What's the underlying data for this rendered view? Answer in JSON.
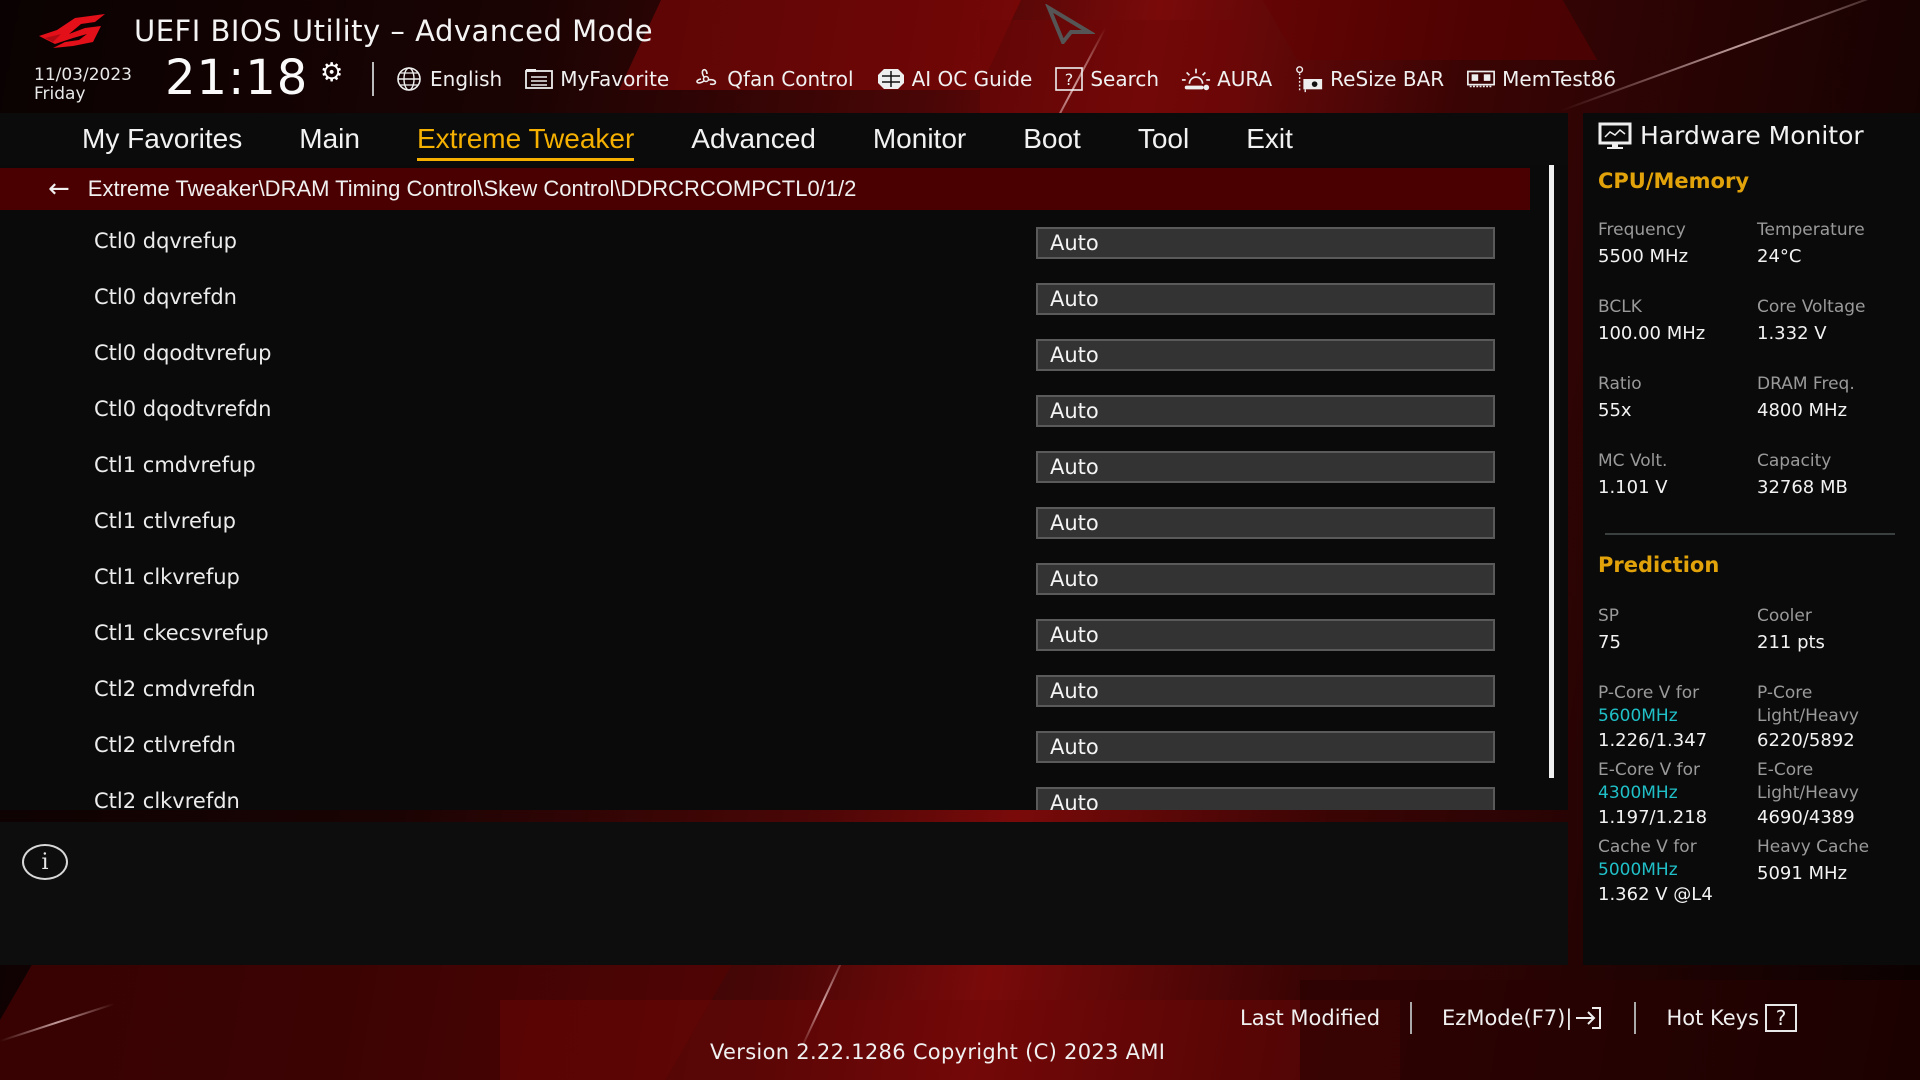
{
  "header": {
    "title": "UEFI BIOS Utility – Advanced Mode",
    "date": "11/03/2023",
    "weekday": "Friday",
    "time": "21:18"
  },
  "toolbar": [
    {
      "label": "English",
      "icon": "globe-icon"
    },
    {
      "label": "MyFavorite",
      "icon": "favorite-list-icon"
    },
    {
      "label": "Qfan Control",
      "icon": "fan-icon"
    },
    {
      "label": "AI OC Guide",
      "icon": "ai-chip-icon"
    },
    {
      "label": "Search",
      "icon": "search-help-icon"
    },
    {
      "label": "AURA",
      "icon": "aura-light-icon"
    },
    {
      "label": "ReSize BAR",
      "icon": "resize-bar-icon"
    },
    {
      "label": "MemTest86",
      "icon": "memory-module-icon"
    }
  ],
  "nav": {
    "tabs": [
      {
        "label": "My Favorites",
        "active": false
      },
      {
        "label": "Main",
        "active": false
      },
      {
        "label": "Extreme Tweaker",
        "active": true
      },
      {
        "label": "Advanced",
        "active": false
      },
      {
        "label": "Monitor",
        "active": false
      },
      {
        "label": "Boot",
        "active": false
      },
      {
        "label": "Tool",
        "active": false
      },
      {
        "label": "Exit",
        "active": false
      }
    ]
  },
  "breadcrumb": {
    "path": "Extreme Tweaker\\DRAM Timing Control\\Skew Control\\DDRCRCOMPCTL0/1/2"
  },
  "settings": [
    {
      "label": "Ctl0 dqvrefup",
      "value": "Auto"
    },
    {
      "label": "Ctl0 dqvrefdn",
      "value": "Auto"
    },
    {
      "label": "Ctl0 dqodtvrefup",
      "value": "Auto"
    },
    {
      "label": "Ctl0 dqodtvrefdn",
      "value": "Auto"
    },
    {
      "label": "Ctl1 cmdvrefup",
      "value": "Auto"
    },
    {
      "label": "Ctl1 ctlvrefup",
      "value": "Auto"
    },
    {
      "label": "Ctl1 clkvrefup",
      "value": "Auto"
    },
    {
      "label": "Ctl1 ckecsvrefup",
      "value": "Auto"
    },
    {
      "label": "Ctl2 cmdvrefdn",
      "value": "Auto"
    },
    {
      "label": "Ctl2 ctlvrefdn",
      "value": "Auto"
    },
    {
      "label": "Ctl2 clkvrefdn",
      "value": "Auto"
    }
  ],
  "hardware_monitor": {
    "title": "Hardware Monitor",
    "cpu_memory": {
      "heading": "CPU/Memory",
      "items": [
        {
          "label": "Frequency",
          "value": "5500 MHz"
        },
        {
          "label": "Temperature",
          "value": "24°C"
        },
        {
          "label": "BCLK",
          "value": "100.00 MHz"
        },
        {
          "label": "Core Voltage",
          "value": "1.332 V"
        },
        {
          "label": "Ratio",
          "value": "55x"
        },
        {
          "label": "DRAM Freq.",
          "value": "4800 MHz"
        },
        {
          "label": "MC Volt.",
          "value": "1.101 V"
        },
        {
          "label": "Capacity",
          "value": "32768 MB"
        }
      ]
    },
    "prediction": {
      "heading": "Prediction",
      "sp": {
        "label": "SP",
        "value": "75"
      },
      "cooler": {
        "label": "Cooler",
        "value": "211 pts"
      },
      "pcore_v": {
        "label": "P-Core V for",
        "freq": "5600MHz",
        "value": "1.226/1.347"
      },
      "pcore_lh": {
        "label": "P-Core",
        "label2": "Light/Heavy",
        "value": "6220/5892"
      },
      "ecore_v": {
        "label": "E-Core V for",
        "freq": "4300MHz",
        "value": "1.197/1.218"
      },
      "ecore_lh": {
        "label": "E-Core",
        "label2": "Light/Heavy",
        "value": "4690/4389"
      },
      "cache_v": {
        "label": "Cache V for",
        "freq": "5000MHz",
        "value": "1.362 V @L4"
      },
      "heavy_cache": {
        "label": "Heavy Cache",
        "value": "5091 MHz"
      }
    }
  },
  "footer": {
    "last_modified": "Last Modified",
    "ezmode": "EzMode(F7)|",
    "hotkeys": "Hot Keys",
    "hotkeys_key": "?",
    "version": "Version 2.22.1286 Copyright (C) 2023 AMI"
  },
  "colors": {
    "accent": "#f5b000",
    "crumb_bg": "#4a0000",
    "highlight_freq": "#20c0c8"
  }
}
